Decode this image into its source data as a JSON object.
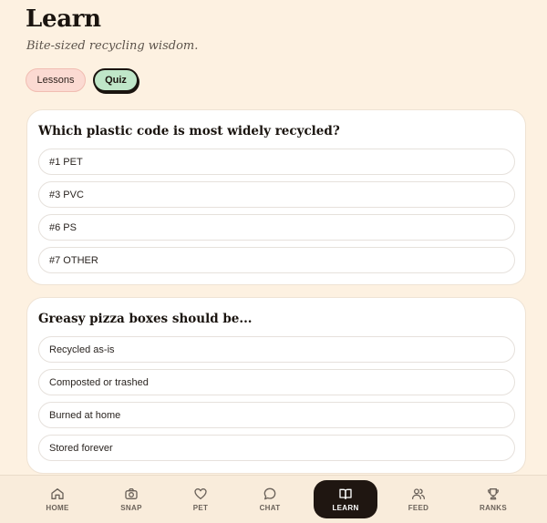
{
  "header": {
    "title": "Learn",
    "subtitle": "Bite-sized recycling wisdom."
  },
  "tabs": [
    {
      "label": "Lessons",
      "active": false
    },
    {
      "label": "Quiz",
      "active": true
    }
  ],
  "quiz": [
    {
      "question": "Which plastic code is most widely recycled?",
      "options": [
        "#1 PET",
        "#3 PVC",
        "#6 PS",
        "#7 OTHER"
      ]
    },
    {
      "question": "Greasy pizza boxes should be...",
      "options": [
        "Recycled as-is",
        "Composted or trashed",
        "Burned at home",
        "Stored forever"
      ]
    }
  ],
  "nav": {
    "items": [
      {
        "label": "HOME",
        "icon": "home-icon"
      },
      {
        "label": "SNAP",
        "icon": "camera-icon"
      },
      {
        "label": "PET",
        "icon": "heart-icon"
      },
      {
        "label": "CHAT",
        "icon": "chat-icon"
      },
      {
        "label": "LEARN",
        "icon": "book-icon",
        "active": true
      },
      {
        "label": "FEED",
        "icon": "users-icon"
      },
      {
        "label": "RANKS",
        "icon": "trophy-icon"
      }
    ]
  },
  "colors": {
    "background": "#fdf1e1",
    "accent_green": "#bfe6c8",
    "accent_pink": "#fbdad2",
    "active_nav": "#1f1611"
  }
}
